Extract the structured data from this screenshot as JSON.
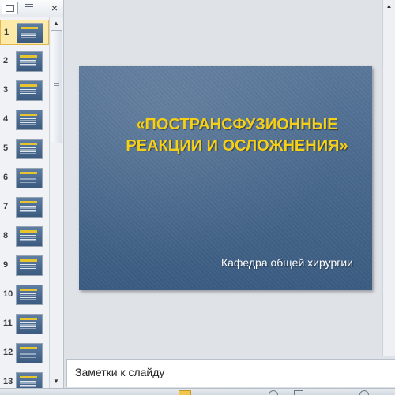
{
  "thumbnail_pane": {
    "close_label": "×",
    "slides": [
      {
        "number": "1",
        "selected": true
      },
      {
        "number": "2"
      },
      {
        "number": "3"
      },
      {
        "number": "4"
      },
      {
        "number": "5"
      },
      {
        "number": "6"
      },
      {
        "number": "7"
      },
      {
        "number": "8"
      },
      {
        "number": "9"
      },
      {
        "number": "10"
      },
      {
        "number": "11"
      },
      {
        "number": "12"
      },
      {
        "number": "13"
      }
    ],
    "scroll_up": "▲",
    "scroll_down": "▼"
  },
  "slide": {
    "title": "«ПОСТРАНСФУЗИОННЫЕ РЕАКЦИИ И ОСЛОЖНЕНИЯ»",
    "subtitle": "Кафедра общей хирургии",
    "title_color": "#f6cf17",
    "background_color": "#4a6a8e"
  },
  "editor": {
    "scroll_up": "▲"
  },
  "notes": {
    "placeholder": "Заметки к слайду"
  },
  "icons": {
    "tab_slides": "slides-view-icon",
    "tab_outline": "outline-view-icon",
    "close": "close-icon"
  }
}
